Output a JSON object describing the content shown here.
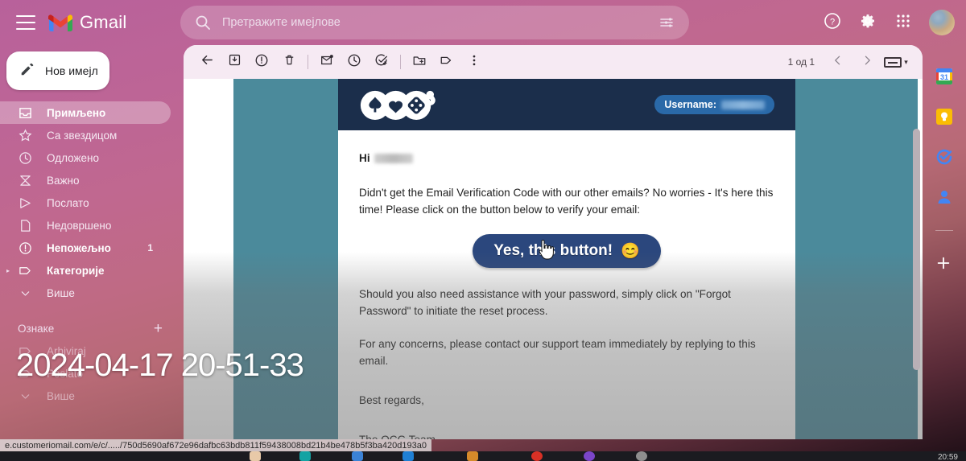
{
  "app": {
    "name": "Gmail",
    "menu_icon": "hamburger-icon",
    "logo_icon": "gmail-logo-icon"
  },
  "search": {
    "placeholder": "Претражите имејлове",
    "value": "",
    "search_icon": "search-icon",
    "filter_icon": "tune-filter-icon"
  },
  "header_actions": [
    {
      "name": "support-button",
      "icon": "help-circle-icon"
    },
    {
      "name": "settings-button",
      "icon": "gear-icon"
    },
    {
      "name": "apps-button",
      "icon": "grid-apps-icon"
    },
    {
      "name": "account-avatar",
      "icon": "avatar-icon"
    }
  ],
  "sidebar": {
    "compose": {
      "label": "Нов имејл",
      "icon": "pencil-icon"
    },
    "items": [
      {
        "label": "Примљено",
        "icon": "inbox-icon",
        "active": true,
        "bold": true,
        "count": ""
      },
      {
        "label": "Са звездицом",
        "icon": "star-icon",
        "active": false,
        "bold": false,
        "count": ""
      },
      {
        "label": "Одложено",
        "icon": "clock-icon",
        "active": false,
        "bold": false,
        "count": ""
      },
      {
        "label": "Важно",
        "icon": "important-icon",
        "active": false,
        "bold": false,
        "count": ""
      },
      {
        "label": "Послато",
        "icon": "send-icon",
        "active": false,
        "bold": false,
        "count": ""
      },
      {
        "label": "Недовршено",
        "icon": "draft-icon",
        "active": false,
        "bold": false,
        "count": ""
      },
      {
        "label": "Непожељно",
        "icon": "spam-icon",
        "active": false,
        "bold": true,
        "count": "1"
      },
      {
        "label": "Категорије",
        "icon": "label-icon",
        "active": false,
        "bold": true,
        "count": "",
        "caret": "▸"
      },
      {
        "label": "Више",
        "icon": "chevron-down-icon",
        "active": false,
        "bold": false,
        "count": ""
      }
    ],
    "labels_header": {
      "title": "Ознаке",
      "add": "+"
    },
    "labels": [
      {
        "label": "Arhiviraj",
        "icon": "label-icon"
      },
      {
        "label": "Poslato",
        "icon": "label-icon"
      },
      {
        "label": "Више",
        "icon": "chevron-down-icon"
      }
    ]
  },
  "mail_toolbar": {
    "buttons": [
      {
        "name": "back-button",
        "icon": "arrow-left-icon"
      },
      {
        "name": "archive-button",
        "icon": "archive-icon"
      },
      {
        "name": "report-spam-button",
        "icon": "exclamation-circle-icon"
      },
      {
        "name": "delete-button",
        "icon": "trash-icon"
      },
      {
        "name": "mark-unread-button",
        "icon": "mail-unread-icon"
      },
      {
        "name": "snooze-button",
        "icon": "clock-icon"
      },
      {
        "name": "add-to-tasks-button",
        "icon": "task-add-icon"
      },
      {
        "name": "move-to-button",
        "icon": "folder-move-icon"
      },
      {
        "name": "labels-button",
        "icon": "label-icon"
      },
      {
        "name": "more-button",
        "icon": "more-vertical-icon"
      }
    ],
    "pagination": {
      "text": "1 од 1",
      "prev_icon": "chevron-left-icon",
      "next_icon": "chevron-right-icon"
    },
    "keyboard_toggle": {
      "icon": "keyboard-icon",
      "caret": "▾"
    }
  },
  "email": {
    "brand": {
      "name": "OCG",
      "logo_icon": "ocg-casino-logo-icon"
    },
    "username_pill": {
      "label": "Username:",
      "value_redacted": true
    },
    "greeting_prefix": "Hi",
    "greeting_name_redacted": true,
    "paragraphs": [
      "Didn't get the Email Verification Code with our other emails? No worries - It's here this time! Please click on the button below to verify your email:",
      "Should you also need assistance with your password, simply click on \"Forgot Password\" to initiate the reset process.",
      "For any concerns, please contact our support team immediately by replying to this email."
    ],
    "italic_phrase": "\"Forgot Password\"",
    "cta_button": {
      "label": "Yes, this button!",
      "emoji": "😊"
    },
    "signoff": "Best regards,",
    "team": "The OCG Team",
    "colors": {
      "header_bg": "#1b2e4b",
      "cta_bg": "#2b477d",
      "pill_bg": "#2a69a8",
      "backdrop_teal": "#4b8a9b"
    }
  },
  "right_panel": [
    {
      "name": "google-calendar-button",
      "icon": "calendar-31-icon"
    },
    {
      "name": "google-keep-button",
      "icon": "lightbulb-icon"
    },
    {
      "name": "google-tasks-button",
      "icon": "tasks-check-icon"
    },
    {
      "name": "google-contacts-button",
      "icon": "contacts-person-icon"
    },
    {
      "name": "add-app-button",
      "icon": "plus-icon"
    }
  ],
  "status_bar": {
    "url": "e.customeriomail.com/e/c/...../750d5690af672e96dafbc63bdb811f59438008bd21b4be478b5f3ba420d193a0"
  },
  "system": {
    "tray_time": "20:59"
  },
  "overlay": {
    "timestamp": "2024-04-17 20-51-33"
  }
}
